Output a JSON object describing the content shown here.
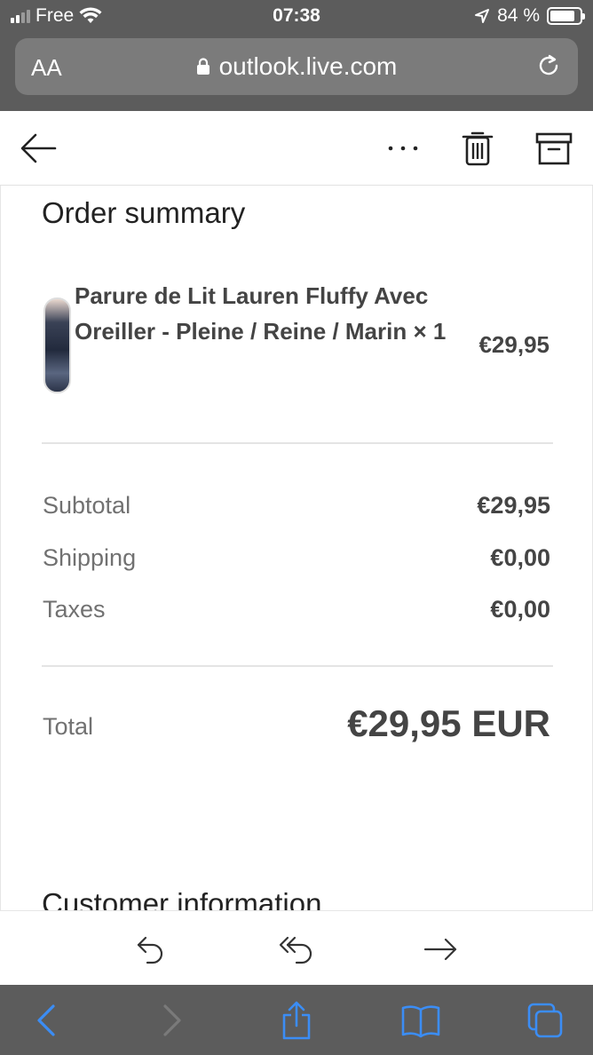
{
  "status_bar": {
    "carrier": "Free",
    "time": "07:38",
    "battery_percent": "84 %",
    "battery_level": 0.84
  },
  "address_bar": {
    "text_size_label": "AA",
    "url": "outlook.live.com"
  },
  "toolbar": {
    "icons": [
      "back-arrow-icon",
      "more-icon",
      "delete-icon",
      "archive-icon"
    ]
  },
  "order": {
    "title": "Order summary",
    "item": {
      "name": "Parure de Lit Lauren Fluffy Avec Oreiller - Pleine / Reine / Marin × 1",
      "price": "€29,95"
    },
    "rows": [
      {
        "label": "Subtotal",
        "value": "€29,95"
      },
      {
        "label": "Shipping",
        "value": "€0,00"
      },
      {
        "label": "Taxes",
        "value": "€0,00"
      }
    ],
    "total_label": "Total",
    "total_value": "€29,95 EUR",
    "next_section_title": "Customer information"
  },
  "reply_bar": {
    "icons": [
      "reply-icon",
      "reply-all-icon",
      "forward-icon"
    ]
  },
  "safari_toolbar": {
    "icons": [
      "back-icon",
      "forward-icon",
      "share-icon",
      "bookmarks-icon",
      "tabs-icon"
    ],
    "accent_color": "#3b8df5"
  }
}
